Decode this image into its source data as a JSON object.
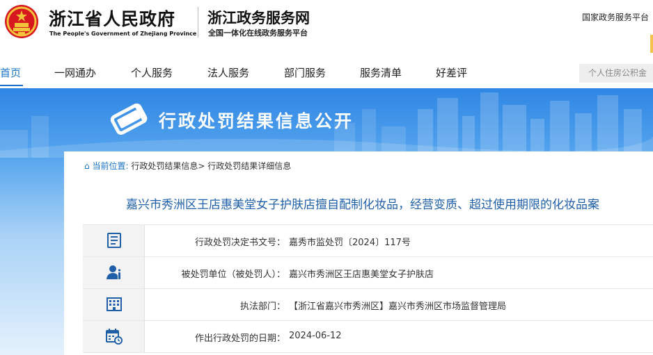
{
  "header": {
    "site_name_cn": "浙江省人民政府",
    "site_name_en": "The People's Government of Zhejiang Province",
    "service_name": "浙江政务服务网",
    "service_subtitle": "全国一体化在线政务服务平台",
    "national_link": "国家政务服务平台",
    "emblem_icon": "national-emblem-icon"
  },
  "nav": {
    "items": [
      {
        "label": "首页",
        "active": true
      },
      {
        "label": "一网通办",
        "active": false
      },
      {
        "label": "个人服务",
        "active": false
      },
      {
        "label": "法人服务",
        "active": false
      },
      {
        "label": "部门服务",
        "active": false
      },
      {
        "label": "服务清单",
        "active": false
      },
      {
        "label": "好差评",
        "active": false
      }
    ],
    "search_placeholder": "个人住房公积金"
  },
  "banner": {
    "title": "行政处罚结果信息公开",
    "icon": "book-icon"
  },
  "breadcrumb": {
    "prefix": "当前位置:",
    "items": [
      "行政处罚结果信息>",
      "行政处罚结果详细信息"
    ],
    "icon": "home-icon"
  },
  "case": {
    "title": "嘉兴市秀洲区王店惠美堂女子护肤店擅自配制化妆品，经营变质、超过使用期限的化妆品案",
    "fields": [
      {
        "icon": "document-icon",
        "label": "行政处罚决定书文号：",
        "value": "嘉秀市监处罚〔2024〕117号"
      },
      {
        "icon": "person-icon",
        "label": "被处罚单位（被处罚人）：",
        "value": "嘉兴市秀洲区王店惠美堂女子护肤店"
      },
      {
        "icon": "building-icon",
        "label": "执法部门：",
        "value": "【浙江省嘉兴市秀洲区】嘉兴市秀洲区市场监督管理局"
      },
      {
        "icon": "calendar-clock-icon",
        "label": "作出行政处罚的日期：",
        "value": "2024-06-12"
      }
    ]
  },
  "colors": {
    "accent": "#1a73c8",
    "title_blue": "#1f5fa8",
    "emblem_red": "#d7191f",
    "emblem_gold": "#f3c33c",
    "banner_top": "#2f86e3"
  }
}
